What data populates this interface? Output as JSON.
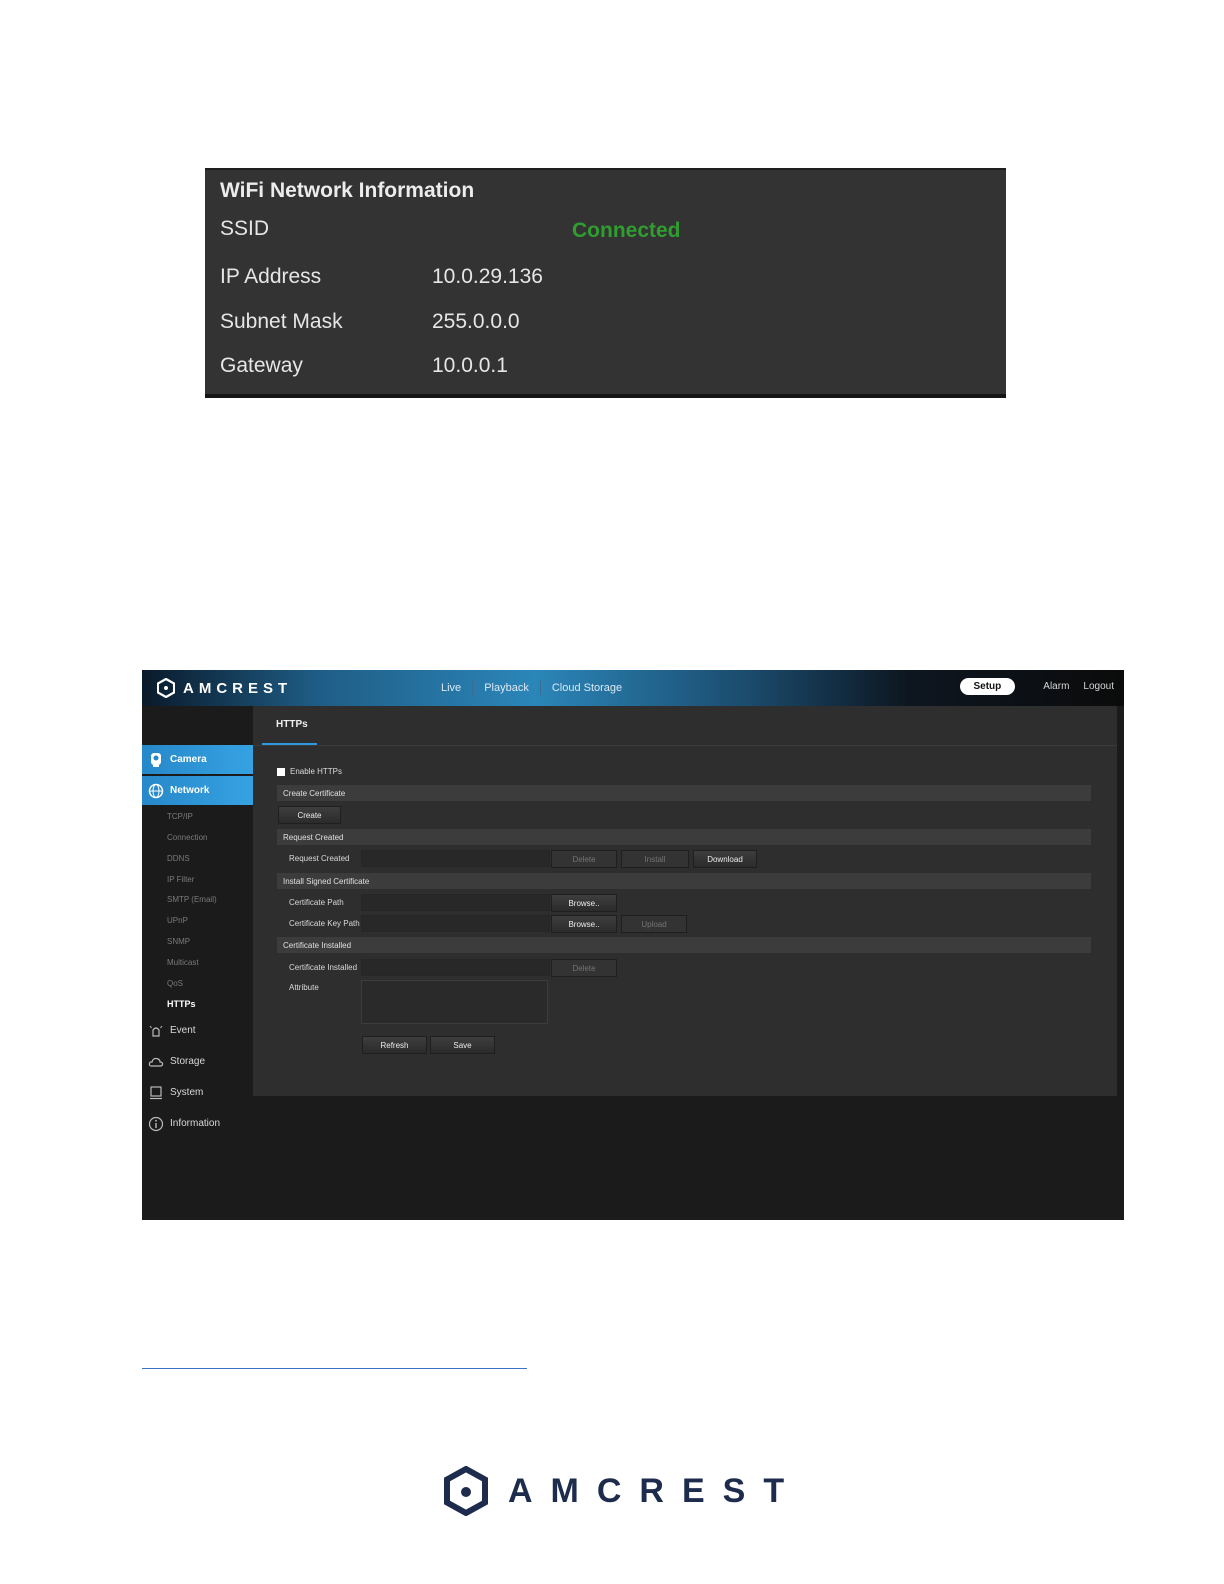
{
  "wifi_panel": {
    "title": "WiFi Network Information",
    "rows": [
      {
        "label": "SSID",
        "value": ""
      },
      {
        "label": "IP Address",
        "value": "10.0.29.136"
      },
      {
        "label": "Subnet Mask",
        "value": "255.0.0.0"
      },
      {
        "label": "Gateway",
        "value": "10.0.0.1"
      }
    ],
    "status": "Connected",
    "status_color": "#2f9e2f"
  },
  "app": {
    "brand": "AMCREST",
    "nav": [
      "Live",
      "Playback",
      "Cloud Storage"
    ],
    "right_nav": {
      "setup": "Setup",
      "alarm": "Alarm",
      "logout": "Logout"
    },
    "accent_color": "#2d9ae0",
    "sidebar": {
      "camera": "Camera",
      "network": "Network",
      "sub_items": [
        "TCP/IP",
        "Connection",
        "DDNS",
        "IP Filter",
        "SMTP (Email)",
        "UPnP",
        "SNMP",
        "Multicast",
        "QoS",
        "HTTPs"
      ],
      "event": "Event",
      "storage": "Storage",
      "system": "System",
      "information": "Information"
    },
    "tab": "HTTPs",
    "enable_label": "Enable HTTPs",
    "enable_checked": false,
    "sections": {
      "create_certificate": "Create Certificate",
      "request_created": "Request Created",
      "install_signed": "Install Signed Certificate",
      "certificate_installed": "Certificate Installed"
    },
    "buttons": {
      "create": "Create",
      "delete": "Delete",
      "install": "Install",
      "download": "Download",
      "browse": "Browse..",
      "upload": "Upload",
      "refresh": "Refresh",
      "save": "Save"
    },
    "fields": {
      "request_created": "Request Created",
      "certificate_path": "Certificate Path",
      "certificate_key_path": "Certificate Key Path",
      "certificate_installed": "Certificate Installed",
      "attribute": "Attribute"
    }
  },
  "footer": {
    "brand": "AMCREST",
    "brand_color": "#1d2b4d"
  }
}
